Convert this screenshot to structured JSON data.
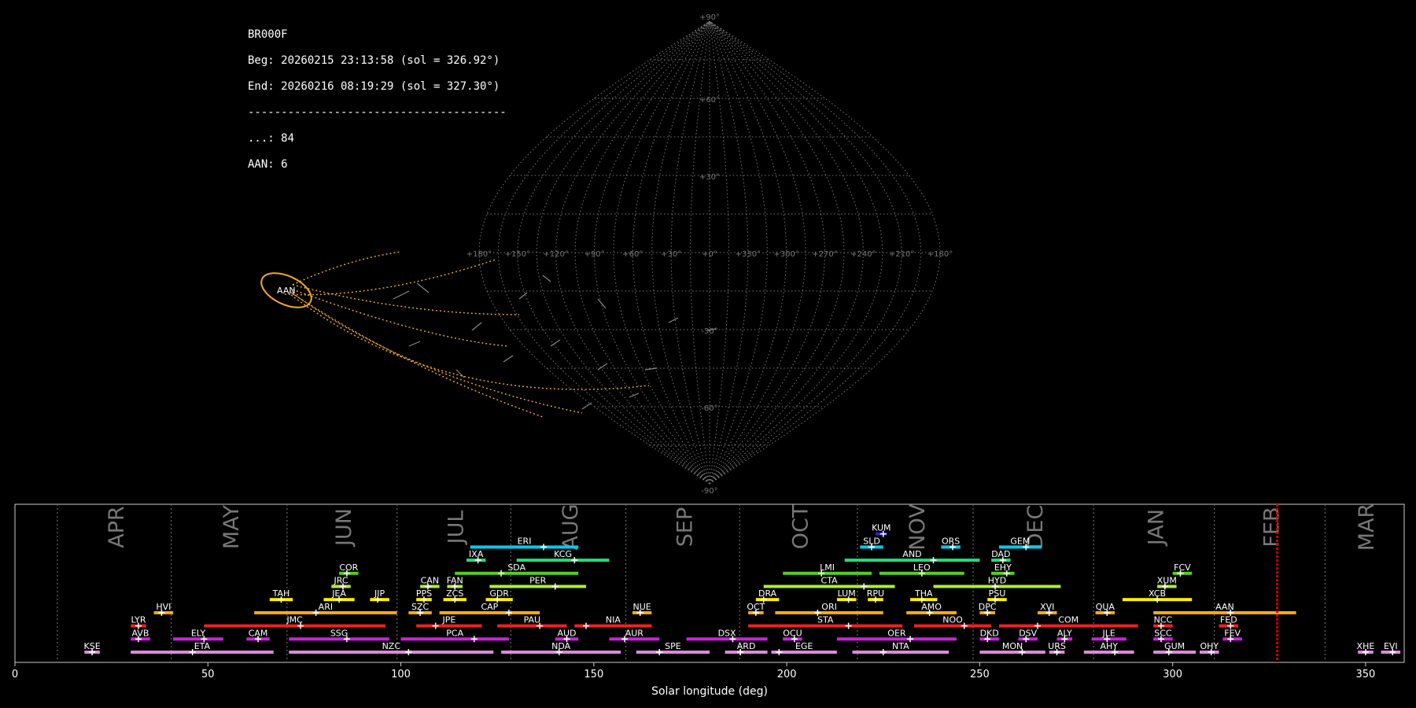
{
  "header": {
    "station": "BR000F",
    "begin": "Beg: 20260215 23:13:58 (sol = 326.92°)",
    "end": "End: 20260216 08:19:29 (sol = 327.30°)",
    "separator": "---------------------------------------",
    "sporadic_count": "...: 84",
    "aan_count": "AAN: 6"
  },
  "colors": {
    "background": "#000000",
    "grid": "#777777",
    "radiant": "#f4a82a",
    "solar_marker": "#cc0000"
  },
  "sky_map": {
    "projection": "sinusoidal",
    "grid": true,
    "longitude_ticks": [
      "+180°",
      "+150°",
      "+120°",
      "+90°",
      "+60°",
      "+30°",
      "+0°",
      "+330°",
      "+300°",
      "+270°",
      "+240°",
      "+210°",
      "+180°"
    ],
    "latitude_ticks": [
      "+90°",
      "+60°",
      "+30°",
      "-30°",
      "-60°",
      "-90°"
    ],
    "radiant_label": "AAN"
  },
  "chart_data": {
    "type": "timeline",
    "xlabel": "Solar longitude (deg)",
    "xlim": [
      0,
      360
    ],
    "xticks": [
      "0",
      "50",
      "100",
      "150",
      "200",
      "250",
      "300",
      "350"
    ],
    "current_sol": 327.1,
    "months": [
      {
        "label": "APR",
        "start": 11
      },
      {
        "label": "MAY",
        "start": 40.5
      },
      {
        "label": "JUN",
        "start": 70.5
      },
      {
        "label": "JUL",
        "start": 99
      },
      {
        "label": "AUG",
        "start": 128.5
      },
      {
        "label": "SEP",
        "start": 158.3
      },
      {
        "label": "OCT",
        "start": 187.8
      },
      {
        "label": "NOV",
        "start": 218.3
      },
      {
        "label": "DEC",
        "start": 248.3
      },
      {
        "label": "JAN",
        "start": 279.5
      },
      {
        "label": "FEB",
        "start": 310.8
      },
      {
        "label": "MAR",
        "start": 339.5
      }
    ],
    "showers": [
      {
        "code": "KUM",
        "start": 223,
        "end": 226,
        "peak": 225,
        "row": 9,
        "color": "#2222cc"
      },
      {
        "code": "ERI",
        "start": 118,
        "end": 146,
        "peak": 137,
        "row": 8,
        "color": "#00ccee"
      },
      {
        "code": "SLD",
        "start": 219,
        "end": 225,
        "peak": 222,
        "row": 8,
        "color": "#00ccee"
      },
      {
        "code": "ORS",
        "start": 240,
        "end": 245,
        "peak": 243,
        "row": 8,
        "color": "#00ccee"
      },
      {
        "code": "GEM",
        "start": 255,
        "end": 266,
        "peak": 262,
        "row": 8,
        "color": "#00ccee"
      },
      {
        "code": "IXA",
        "start": 117,
        "end": 122,
        "peak": 120,
        "row": 7,
        "color": "#22dd77"
      },
      {
        "code": "KCG",
        "start": 130,
        "end": 154,
        "peak": 145,
        "row": 7,
        "color": "#22dd77"
      },
      {
        "code": "AND",
        "start": 215,
        "end": 250,
        "peak": 238,
        "row": 7,
        "color": "#22dd77"
      },
      {
        "code": "DAD",
        "start": 253,
        "end": 258,
        "peak": 256,
        "row": 7,
        "color": "#22dd77"
      },
      {
        "code": "COR",
        "start": 84,
        "end": 89,
        "peak": 86,
        "row": 6,
        "color": "#55cc22"
      },
      {
        "code": "SDA",
        "start": 114,
        "end": 146,
        "peak": 126,
        "row": 6,
        "color": "#55cc22"
      },
      {
        "code": "LMI",
        "start": 199,
        "end": 222,
        "peak": 209,
        "row": 6,
        "color": "#55cc22"
      },
      {
        "code": "LEO",
        "start": 224,
        "end": 246,
        "peak": 235,
        "row": 6,
        "color": "#55cc22"
      },
      {
        "code": "EHY",
        "start": 253,
        "end": 259,
        "peak": 257,
        "row": 6,
        "color": "#55cc22"
      },
      {
        "code": "FCV",
        "start": 300,
        "end": 305,
        "peak": 302,
        "row": 6,
        "color": "#55cc22"
      },
      {
        "code": "JRC",
        "start": 82,
        "end": 87,
        "peak": 85,
        "row": 5,
        "color": "#aaee33"
      },
      {
        "code": "CAN",
        "start": 105,
        "end": 110,
        "peak": 107,
        "row": 5,
        "color": "#aaee33"
      },
      {
        "code": "FAN",
        "start": 112,
        "end": 116,
        "peak": 114,
        "row": 5,
        "color": "#aaee33"
      },
      {
        "code": "PER",
        "start": 123,
        "end": 148,
        "peak": 140,
        "row": 5,
        "color": "#aaee33"
      },
      {
        "code": "CTA",
        "start": 194,
        "end": 228,
        "peak": 220,
        "row": 5,
        "color": "#aaee33"
      },
      {
        "code": "HYD",
        "start": 238,
        "end": 271,
        "peak": 254,
        "row": 5,
        "color": "#aaee33"
      },
      {
        "code": "XUM",
        "start": 296,
        "end": 301,
        "peak": 298,
        "row": 5,
        "color": "#aaee33"
      },
      {
        "code": "TAH",
        "start": 66,
        "end": 72,
        "peak": 69,
        "row": 4,
        "color": "#ffee00"
      },
      {
        "code": "JEA",
        "start": 80,
        "end": 88,
        "peak": 84,
        "row": 4,
        "color": "#ffee00"
      },
      {
        "code": "JIP",
        "start": 92,
        "end": 97,
        "peak": 94,
        "row": 4,
        "color": "#ffee00"
      },
      {
        "code": "PPS",
        "start": 104,
        "end": 108,
        "peak": 106,
        "row": 4,
        "color": "#ffee00"
      },
      {
        "code": "ZCS",
        "start": 111,
        "end": 117,
        "peak": 114,
        "row": 4,
        "color": "#ffee00"
      },
      {
        "code": "GDR",
        "start": 122,
        "end": 129,
        "peak": 125,
        "row": 4,
        "color": "#ffee00"
      },
      {
        "code": "DRA",
        "start": 192,
        "end": 198,
        "peak": 194,
        "row": 4,
        "color": "#ffee00"
      },
      {
        "code": "LUM",
        "start": 213,
        "end": 218,
        "peak": 216,
        "row": 4,
        "color": "#ffee00"
      },
      {
        "code": "RPU",
        "start": 221,
        "end": 225,
        "peak": 223,
        "row": 4,
        "color": "#ffee00"
      },
      {
        "code": "THA",
        "start": 232,
        "end": 239,
        "peak": 235,
        "row": 4,
        "color": "#ffee00"
      },
      {
        "code": "PSU",
        "start": 252,
        "end": 257,
        "peak": 254,
        "row": 4,
        "color": "#ffee00"
      },
      {
        "code": "XCB",
        "start": 287,
        "end": 305,
        "peak": 296,
        "row": 4,
        "color": "#ffee00"
      },
      {
        "code": "HVI",
        "start": 36,
        "end": 41,
        "peak": 38,
        "row": 3,
        "color": "#ffaa11"
      },
      {
        "code": "ARI",
        "start": 62,
        "end": 99,
        "peak": 78,
        "row": 3,
        "color": "#ffaa11"
      },
      {
        "code": "SZC",
        "start": 102,
        "end": 108,
        "peak": 105,
        "row": 3,
        "color": "#ffaa11"
      },
      {
        "code": "CAP",
        "start": 110,
        "end": 136,
        "peak": 128,
        "row": 3,
        "color": "#ffaa11"
      },
      {
        "code": "NUE",
        "start": 160,
        "end": 165,
        "peak": 162,
        "row": 3,
        "color": "#ffaa11"
      },
      {
        "code": "OCT",
        "start": 190,
        "end": 194,
        "peak": 192,
        "row": 3,
        "color": "#ffaa11"
      },
      {
        "code": "ORI",
        "start": 197,
        "end": 225,
        "peak": 208,
        "row": 3,
        "color": "#ffaa11"
      },
      {
        "code": "AMO",
        "start": 231,
        "end": 244,
        "peak": 237,
        "row": 3,
        "color": "#ffaa11"
      },
      {
        "code": "DPC",
        "start": 250,
        "end": 254,
        "peak": 252,
        "row": 3,
        "color": "#ffaa11"
      },
      {
        "code": "XVI",
        "start": 265,
        "end": 270,
        "peak": 268,
        "row": 3,
        "color": "#ffaa11"
      },
      {
        "code": "QUA",
        "start": 280,
        "end": 285,
        "peak": 283,
        "row": 3,
        "color": "#ffaa11"
      },
      {
        "code": "AAN",
        "start": 295,
        "end": 332,
        "peak": 315,
        "row": 3,
        "color": "#ffaa11"
      },
      {
        "code": "LYR",
        "start": 30,
        "end": 34,
        "peak": 32,
        "row": 2,
        "color": "#ee2222"
      },
      {
        "code": "JMC",
        "start": 49,
        "end": 96,
        "peak": 74,
        "row": 2,
        "color": "#ee2222"
      },
      {
        "code": "JPE",
        "start": 104,
        "end": 121,
        "peak": 109,
        "row": 2,
        "color": "#ee2222"
      },
      {
        "code": "PAU",
        "start": 125,
        "end": 143,
        "peak": 136,
        "row": 2,
        "color": "#ee2222"
      },
      {
        "code": "NIA",
        "start": 145,
        "end": 165,
        "peak": 148,
        "row": 2,
        "color": "#ee2222"
      },
      {
        "code": "STA",
        "start": 190,
        "end": 230,
        "peak": 216,
        "row": 2,
        "color": "#ee2222"
      },
      {
        "code": "NOO",
        "start": 233,
        "end": 253,
        "peak": 246,
        "row": 2,
        "color": "#ee2222"
      },
      {
        "code": "COM",
        "start": 255,
        "end": 291,
        "peak": 265,
        "row": 2,
        "color": "#ee2222"
      },
      {
        "code": "NCC",
        "start": 295,
        "end": 300,
        "peak": 297,
        "row": 2,
        "color": "#ee2222"
      },
      {
        "code": "FED",
        "start": 312,
        "end": 317,
        "peak": 315,
        "row": 2,
        "color": "#ee2222"
      },
      {
        "code": "AVB",
        "start": 30,
        "end": 35,
        "peak": 32,
        "row": 1,
        "color": "#cc22dd"
      },
      {
        "code": "ELY",
        "start": 41,
        "end": 54,
        "peak": 49,
        "row": 1,
        "color": "#cc22dd"
      },
      {
        "code": "CAM",
        "start": 60,
        "end": 66,
        "peak": 63,
        "row": 1,
        "color": "#cc22dd"
      },
      {
        "code": "SSG",
        "start": 71,
        "end": 97,
        "peak": 86,
        "row": 1,
        "color": "#cc22dd"
      },
      {
        "code": "PCA",
        "start": 100,
        "end": 128,
        "peak": 119,
        "row": 1,
        "color": "#cc22dd"
      },
      {
        "code": "AUD",
        "start": 140,
        "end": 146,
        "peak": 143,
        "row": 1,
        "color": "#cc22dd"
      },
      {
        "code": "AUR",
        "start": 154,
        "end": 167,
        "peak": 158,
        "row": 1,
        "color": "#cc22dd"
      },
      {
        "code": "DSX",
        "start": 174,
        "end": 195,
        "peak": 186,
        "row": 1,
        "color": "#cc22dd"
      },
      {
        "code": "OCU",
        "start": 199,
        "end": 204,
        "peak": 202,
        "row": 1,
        "color": "#cc22dd"
      },
      {
        "code": "OER",
        "start": 213,
        "end": 244,
        "peak": 232,
        "row": 1,
        "color": "#cc22dd"
      },
      {
        "code": "DKD",
        "start": 250,
        "end": 255,
        "peak": 252,
        "row": 1,
        "color": "#cc22dd"
      },
      {
        "code": "DSV",
        "start": 260,
        "end": 265,
        "peak": 262,
        "row": 1,
        "color": "#cc22dd"
      },
      {
        "code": "ALY",
        "start": 270,
        "end": 274,
        "peak": 272,
        "row": 1,
        "color": "#cc22dd"
      },
      {
        "code": "JLE",
        "start": 279,
        "end": 288,
        "peak": 283,
        "row": 1,
        "color": "#cc22dd"
      },
      {
        "code": "SCC",
        "start": 295,
        "end": 300,
        "peak": 297,
        "row": 1,
        "color": "#cc22dd"
      },
      {
        "code": "FEV",
        "start": 313,
        "end": 318,
        "peak": 315,
        "row": 1,
        "color": "#cc22dd"
      },
      {
        "code": "KSE",
        "start": 18,
        "end": 22,
        "peak": 20,
        "row": 0,
        "color": "#dd88dd"
      },
      {
        "code": "ETA",
        "start": 30,
        "end": 67,
        "peak": 46,
        "row": 0,
        "color": "#dd88dd"
      },
      {
        "code": "NZC",
        "start": 71,
        "end": 124,
        "peak": 102,
        "row": 0,
        "color": "#dd88dd"
      },
      {
        "code": "NDA",
        "start": 126,
        "end": 157,
        "peak": 141,
        "row": 0,
        "color": "#dd88dd"
      },
      {
        "code": "SPE",
        "start": 161,
        "end": 180,
        "peak": 167,
        "row": 0,
        "color": "#dd88dd"
      },
      {
        "code": "ARD",
        "start": 184,
        "end": 195,
        "peak": 188,
        "row": 0,
        "color": "#dd88dd"
      },
      {
        "code": "EGE",
        "start": 196,
        "end": 213,
        "peak": 198,
        "row": 0,
        "color": "#dd88dd"
      },
      {
        "code": "NTA",
        "start": 217,
        "end": 242,
        "peak": 225,
        "row": 0,
        "color": "#dd88dd"
      },
      {
        "code": "MON",
        "start": 250,
        "end": 267,
        "peak": 261,
        "row": 0,
        "color": "#dd88dd"
      },
      {
        "code": "URS",
        "start": 268,
        "end": 272,
        "peak": 270,
        "row": 0,
        "color": "#dd88dd"
      },
      {
        "code": "AHY",
        "start": 277,
        "end": 290,
        "peak": 285,
        "row": 0,
        "color": "#dd88dd"
      },
      {
        "code": "GUM",
        "start": 295,
        "end": 306,
        "peak": 299,
        "row": 0,
        "color": "#dd88dd"
      },
      {
        "code": "OHY",
        "start": 307,
        "end": 312,
        "peak": 310,
        "row": 0,
        "color": "#dd88dd"
      },
      {
        "code": "XHE",
        "start": 348,
        "end": 352,
        "peak": 350,
        "row": 0,
        "color": "#dd88dd"
      },
      {
        "code": "EVI",
        "start": 354,
        "end": 359,
        "peak": 357,
        "row": 0,
        "color": "#dd88dd"
      }
    ]
  }
}
